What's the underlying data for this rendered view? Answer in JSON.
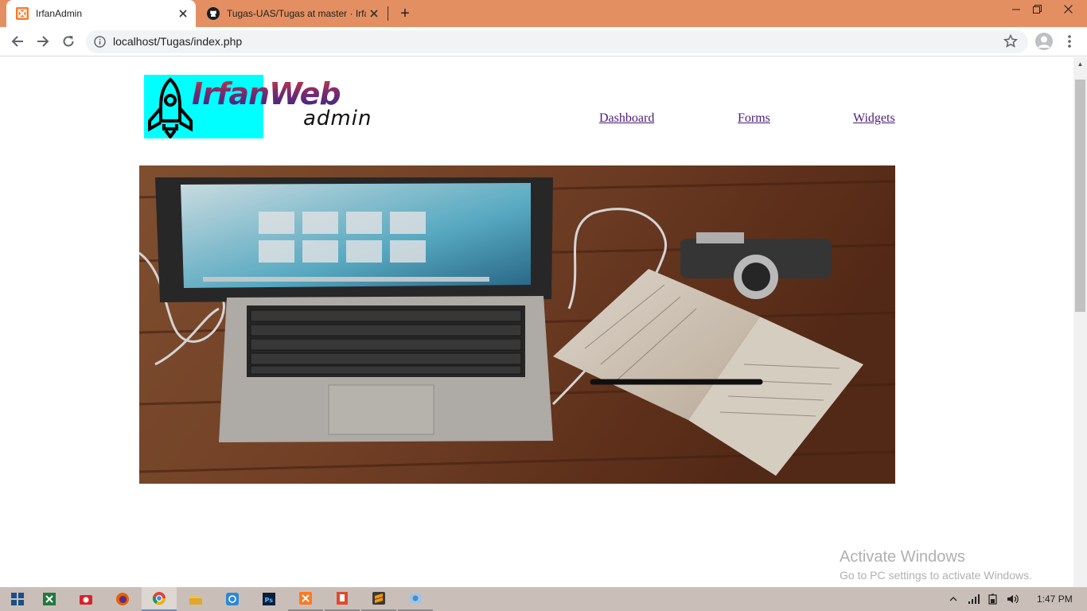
{
  "browser": {
    "tabs": [
      {
        "title": "IrfanAdmin",
        "favicon": "xampp-icon",
        "active": true
      },
      {
        "title": "Tugas-UAS/Tugas at master · Irfa",
        "favicon": "github-icon",
        "active": false
      }
    ],
    "new_tab_label": "+",
    "address": "localhost/Tugas/index.php"
  },
  "page": {
    "logo": {
      "title": "IrfanWeb",
      "subtitle": "admin"
    },
    "nav": [
      {
        "label": "Dashboard"
      },
      {
        "label": "Forms"
      },
      {
        "label": "Widgets"
      }
    ],
    "hero_alt": "laptop-notebook-camera-photo"
  },
  "watermark": {
    "title": "Activate Windows",
    "subtitle": "Go to PC settings to activate Windows."
  },
  "taskbar": {
    "apps": [
      "windows-start-icon",
      "excel-icon",
      "camera-app-icon",
      "firefox-icon",
      "chrome-icon",
      "file-explorer-icon",
      "store-icon",
      "photoshop-icon",
      "xampp-icon",
      "office-lens-icon",
      "sublime-text-icon",
      "control-panel-icon"
    ],
    "clock": "1:47 PM"
  },
  "colors": {
    "tabstrip": "#e48f62",
    "logo_box": "#00ffff",
    "link": "#4b1b7a",
    "taskbar": "#c9bfb8"
  }
}
